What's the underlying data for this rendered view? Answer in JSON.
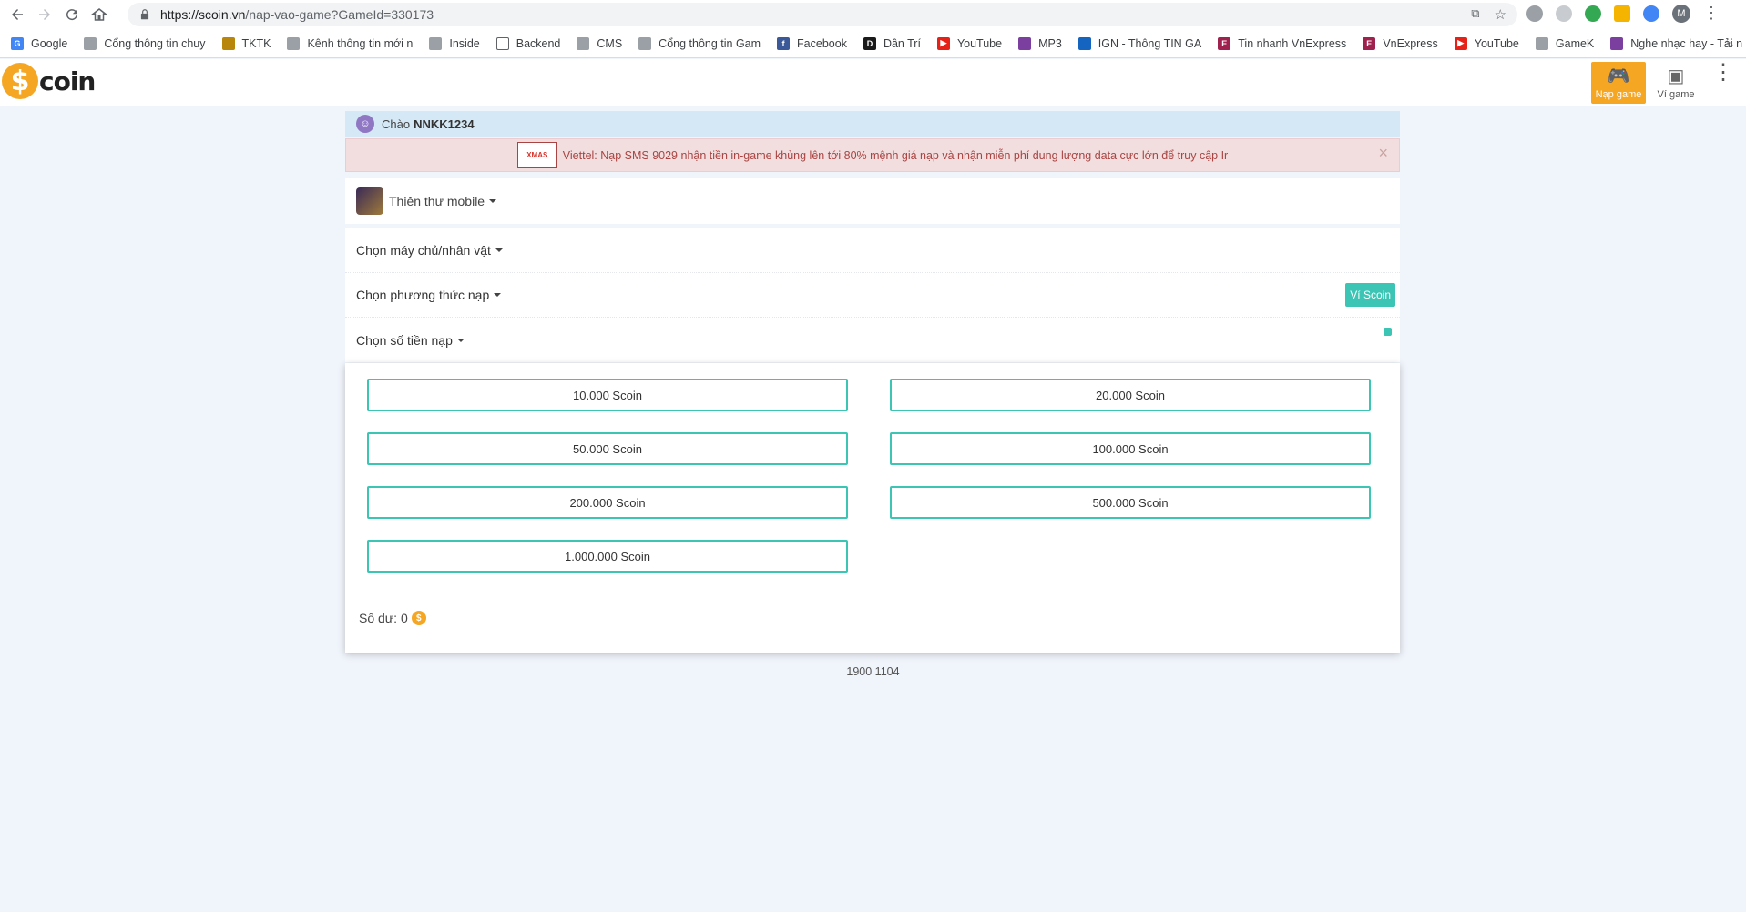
{
  "browser": {
    "url_host": "https://scoin.vn",
    "url_path": "/nap-vao-game?GameId=330173",
    "profile_initial": "M",
    "bookmarks": [
      {
        "label": "Google",
        "color": "#4285f4",
        "glyph": "G"
      },
      {
        "label": "Cổng thông tin chuy",
        "color": "#9aa0a6",
        "glyph": ""
      },
      {
        "label": "TKTK",
        "color": "#b8860b",
        "glyph": ""
      },
      {
        "label": "Kênh thông tin mới n",
        "color": "#9aa0a6",
        "glyph": ""
      },
      {
        "label": "Inside",
        "color": "#9aa0a6",
        "glyph": ""
      },
      {
        "label": "Backend",
        "color": "#ffffff",
        "glyph": ""
      },
      {
        "label": "CMS",
        "color": "#9aa0a6",
        "glyph": ""
      },
      {
        "label": "Cổng thông tin Gam",
        "color": "#9aa0a6",
        "glyph": ""
      },
      {
        "label": "Facebook",
        "color": "#3b5998",
        "glyph": "f"
      },
      {
        "label": "Dân Trí",
        "color": "#1a1a1a",
        "glyph": "D"
      },
      {
        "label": "YouTube",
        "color": "#e62117",
        "glyph": "▶"
      },
      {
        "label": "MP3",
        "color": "#7b3fa0",
        "glyph": ""
      },
      {
        "label": "IGN - Thông TIN GA",
        "color": "#1565c0",
        "glyph": ""
      },
      {
        "label": "Tin nhanh VnExpress",
        "color": "#9f224e",
        "glyph": "E"
      },
      {
        "label": "VnExpress",
        "color": "#9f224e",
        "glyph": "E"
      },
      {
        "label": "YouTube",
        "color": "#e62117",
        "glyph": "▶"
      },
      {
        "label": "GameK",
        "color": "#9aa0a6",
        "glyph": ""
      },
      {
        "label": "Nghe nhạc hay - Tải n",
        "color": "#7b3fa0",
        "glyph": ""
      }
    ],
    "more": "»"
  },
  "header": {
    "logo_symbol": "$",
    "logo_text": "coin",
    "game_button": "Nạp game",
    "wallet_button": "Ví game"
  },
  "greeting": {
    "prefix": "Chào",
    "username": "NNKK1234"
  },
  "alert": {
    "promo_text": "XMAS",
    "message": "Viettel: Nạp SMS 9029 nhận tiền in-game khủng lên tới 80% mệnh giá nạp và nhận miễn phí dung lượng data cực lớn để truy cập Ir",
    "close": "×"
  },
  "game": {
    "name": "Thiên thư mobile"
  },
  "selectors": {
    "server": "Chọn máy chủ/nhân vật",
    "method": "Chọn phương thức nạp",
    "amount": "Chọn số tiền nạp",
    "wallet_badge": "Ví Scoin"
  },
  "amounts": [
    "10.000 Scoin",
    "20.000 Scoin",
    "50.000 Scoin",
    "100.000 Scoin",
    "200.000 Scoin",
    "500.000 Scoin",
    "1.000.000 Scoin"
  ],
  "balance": {
    "label": "Số dư: 0",
    "coin": "$"
  },
  "footer": {
    "phone": "1900 1104"
  },
  "colors": {
    "accent": "#3cc4b4",
    "brand": "#f5a623",
    "alert_text": "#a94442"
  }
}
